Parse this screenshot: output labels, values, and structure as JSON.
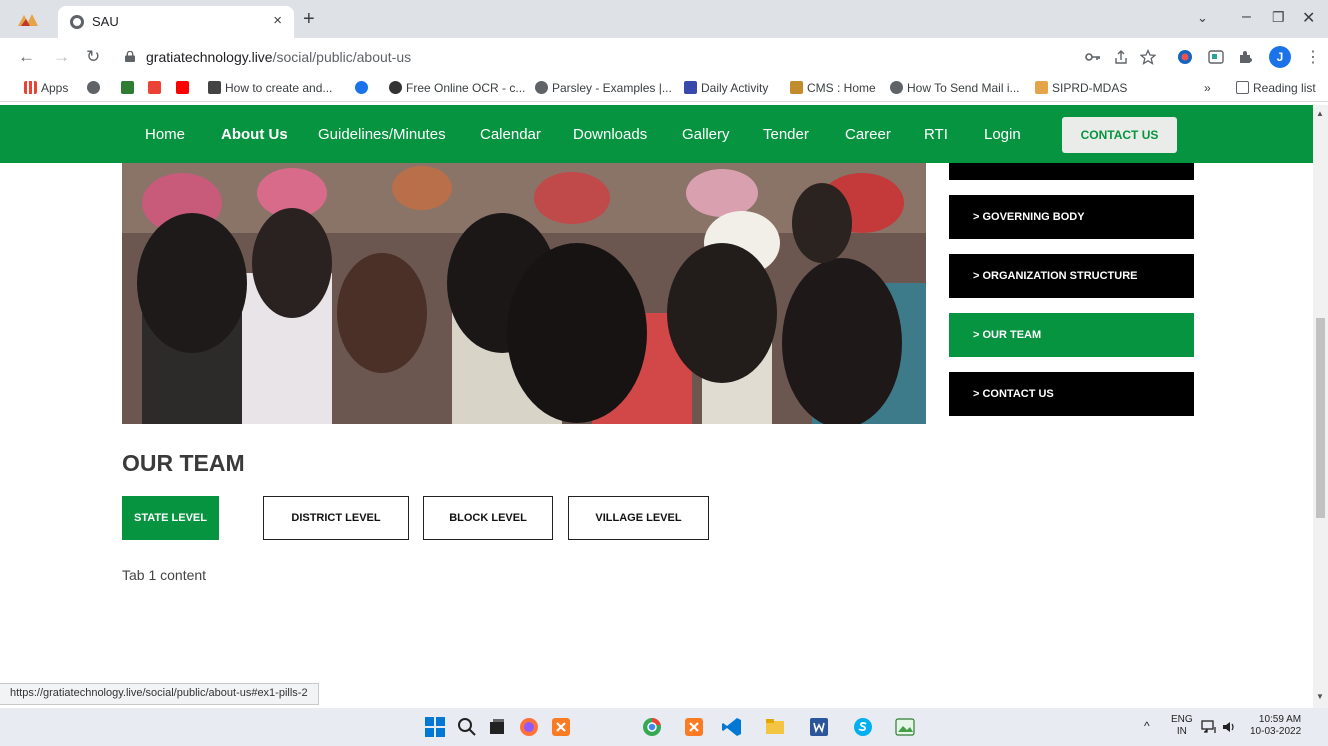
{
  "browser": {
    "tab_title": "SAU",
    "tab_close": "×",
    "new_tab": "+",
    "url_host": "gratiatechnology.live",
    "url_path": "/social/public/about-us",
    "bookmarks": [
      {
        "label": "Apps",
        "color": "#1a73e8"
      },
      {
        "label": "",
        "color": "#5f6368"
      },
      {
        "label": "",
        "color": "#2e7d32"
      },
      {
        "label": "M",
        "color": "#ffffff"
      },
      {
        "label": "",
        "color": "#ff0000"
      },
      {
        "label": "How to create and...",
        "color": "#444444"
      },
      {
        "label": "",
        "color": "#1a73e8"
      },
      {
        "label": "Free Online OCR - c...",
        "color": "#333333"
      },
      {
        "label": "Parsley - Examples |...",
        "color": "#5f6368"
      },
      {
        "label": "Daily Activity",
        "color": "#3949ab"
      },
      {
        "label": "CMS : Home",
        "color": "#c28b2c"
      },
      {
        "label": "How To Send Mail i...",
        "color": "#5f6368"
      },
      {
        "label": "SIPRD-MDAS",
        "color": "#e4a54a"
      }
    ],
    "bookmarks_more": "»",
    "reading_list": "Reading list",
    "avatar_letter": "J",
    "status_url": "https://gratiatechnology.live/social/public/about-us#ex1-pills-2"
  },
  "site": {
    "nav": [
      {
        "label": "Home",
        "active": false
      },
      {
        "label": "About Us",
        "active": true
      },
      {
        "label": "Guidelines/Minutes",
        "active": false
      },
      {
        "label": "Calendar",
        "active": false
      },
      {
        "label": "Downloads",
        "active": false
      },
      {
        "label": "Gallery",
        "active": false
      },
      {
        "label": "Tender",
        "active": false
      },
      {
        "label": "Career",
        "active": false
      },
      {
        "label": "RTI",
        "active": false
      },
      {
        "label": "Login",
        "active": false
      }
    ],
    "nav_contact": "CONTACT US",
    "sidebar": [
      {
        "label": "",
        "active": false
      },
      {
        "label": "> GOVERNING BODY",
        "active": false
      },
      {
        "label": "> ORGANIZATION STRUCTURE",
        "active": false
      },
      {
        "label": "> OUR TEAM",
        "active": true
      },
      {
        "label": "> CONTACT US",
        "active": false
      }
    ],
    "section_title": "OUR TEAM",
    "pills": [
      {
        "label": "STATE LEVEL",
        "active": true
      },
      {
        "label": "DISTRICT LEVEL",
        "active": false
      },
      {
        "label": "BLOCK LEVEL",
        "active": false
      },
      {
        "label": "VILLAGE LEVEL",
        "active": false
      }
    ],
    "tab_content": "Tab 1 content",
    "accent_color": "#079440"
  },
  "taskbar": {
    "lang_top": "ENG",
    "lang_bottom": "IN",
    "time": "10:59 AM",
    "date": "10-03-2022"
  }
}
